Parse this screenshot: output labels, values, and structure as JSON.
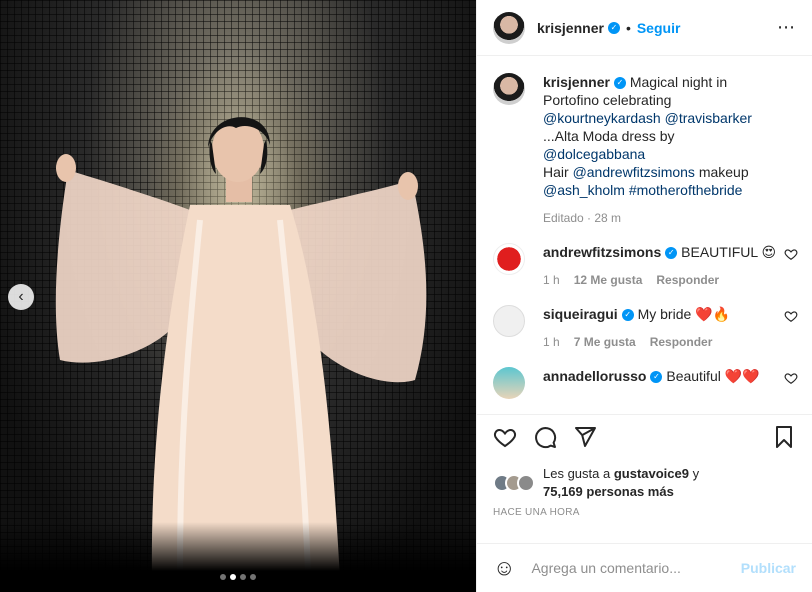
{
  "header": {
    "username": "krisjenner",
    "separator": "•",
    "follow_label": "Seguir",
    "more_icon": "⋯"
  },
  "caption": {
    "username": "krisjenner",
    "text_1": "Magical night in Portofino celebrating ",
    "mention_1": "@kourtneykardash",
    "mention_2": "@travisbarker",
    "text_2": " ...Alta Moda dress by ",
    "mention_3": "@dolcegabbana",
    "text_3": "Hair ",
    "mention_4": "@andrewfitzsimons",
    "text_4": " makeup ",
    "mention_5": "@ash_kholm",
    "hashtag": "#motherofthebride",
    "meta": "Editado · 28 m"
  },
  "comments": [
    {
      "username": "andrewfitzsimons",
      "text": "BEAUTIFUL 😍",
      "time": "1 h",
      "likes": "12 Me gusta",
      "reply": "Responder"
    },
    {
      "username": "siqueiragui",
      "text": "My bride ❤️🔥",
      "time": "1 h",
      "likes": "7 Me gusta",
      "reply": "Responder"
    },
    {
      "username": "annadellorusso",
      "text": "Beautiful ❤️❤️"
    }
  ],
  "likes": {
    "prefix": "Les gusta a ",
    "user": "gustavoice9",
    "and": " y",
    "count": "75,169 personas más"
  },
  "timestamp": "HACE UNA HORA",
  "comment_input": {
    "placeholder": "Agrega un comentario...",
    "post_label": "Publicar"
  },
  "carousel": {
    "prev_icon": "‹",
    "total_slides": 4,
    "active_slide": 2
  },
  "colors": {
    "accent": "#0095f6",
    "link": "#00376b",
    "muted": "#8e8e8e",
    "like_red": "#ed4956"
  }
}
